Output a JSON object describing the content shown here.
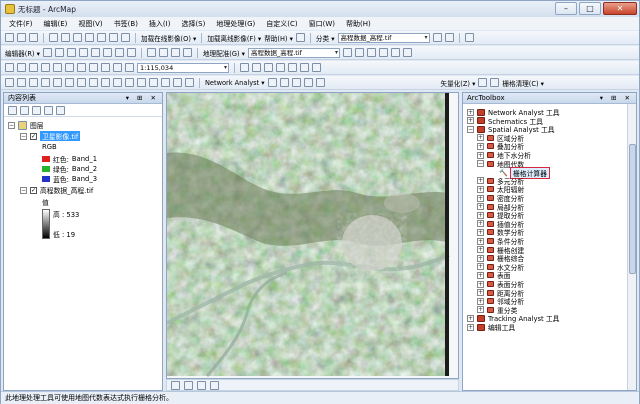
{
  "window": {
    "title": "无标题 - ArcMap",
    "minimize": "–",
    "maximize": "□",
    "close": "✕"
  },
  "menu": [
    "文件(F)",
    "编辑(E)",
    "视图(V)",
    "书签(B)",
    "插入(I)",
    "选择(S)",
    "地理处理(G)",
    "自定义(C)",
    "窗口(W)",
    "帮助(H)"
  ],
  "toolbar1": {
    "basemap_online": "加载在线影像(O) ▾",
    "basemap_offline": "加载离线影像(F) ▾",
    "help": "帮助(H) ▾",
    "classify_label": "分类 ▾",
    "layer_combo": "高程数据_高程.tif"
  },
  "toolbar2": {
    "edit": "编辑器(R) ▾",
    "georef": "地理配准(G) ▾",
    "georef_layer": "高程数据_高程.tif"
  },
  "toolbar3": {
    "scale": "1:115,034"
  },
  "toolbar4": {
    "network_analyst": "Network Analyst ▾",
    "vector_label": "矢量化(Z) ▾",
    "raster_clean": "栅格清理(C) ▾"
  },
  "toc": {
    "title": "内容列表",
    "root": "图层",
    "layer1": "卫星影像.tif",
    "rgb": "RGB",
    "bands": [
      {
        "label": "红色:",
        "band": "Band_1",
        "color": "#e0201f"
      },
      {
        "label": "绿色:",
        "band": "Band_2",
        "color": "#27b42a"
      },
      {
        "label": "蓝色:",
        "band": "Band_3",
        "color": "#2233cc"
      }
    ],
    "layer2": "高程数据_高程.tif",
    "value_label": "值",
    "high": "高 : 533",
    "low": "低 : 19"
  },
  "arctoolbox": {
    "title": "ArcToolbox",
    "top_items": [
      "Network Analyst 工具",
      "Schematics 工具",
      "Spatial Analyst 工具"
    ],
    "sa_children_before": [
      "区域分析",
      "叠加分析",
      "地下水分析",
      "地图代数"
    ],
    "selected_tool": "栅格计算器",
    "sa_children_after": [
      "多元分析",
      "太阳辐射",
      "密度分析",
      "局部分析",
      "提取分析",
      "插值分析",
      "数学分析",
      "条件分析",
      "栅格创建",
      "栅格综合",
      "水文分析",
      "表面",
      "表面分析",
      "距离分析",
      "邻域分析",
      "重分类"
    ],
    "bottom_items": [
      "Tracking Analyst 工具",
      "编辑工具"
    ]
  },
  "status": "此地理处理工具可使用地图代数表达式执行栅格分析。"
}
